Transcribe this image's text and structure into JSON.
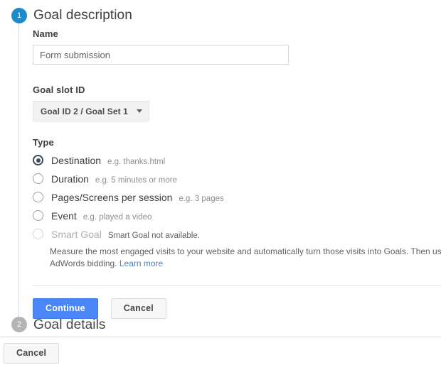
{
  "steps": [
    {
      "number": "1",
      "title": "Goal description",
      "color": "#1f8ac9"
    },
    {
      "number": "2",
      "title": "Goal details",
      "color": "#b4b4b4"
    }
  ],
  "form": {
    "name_label": "Name",
    "name_value": "Form submission",
    "name_placeholder": "",
    "slot_label": "Goal slot ID",
    "slot_value": "Goal ID 2 / Goal Set 1",
    "type_label": "Type"
  },
  "type_options": [
    {
      "label": "Destination",
      "hint": "e.g. thanks.html",
      "selected": true,
      "disabled": false
    },
    {
      "label": "Duration",
      "hint": "e.g. 5 minutes or more",
      "selected": false,
      "disabled": false
    },
    {
      "label": "Pages/Screens per session",
      "hint": "e.g. 3 pages",
      "selected": false,
      "disabled": false
    },
    {
      "label": "Event",
      "hint": "e.g. played a video",
      "selected": false,
      "disabled": false
    },
    {
      "label": "Smart Goal",
      "hint": "Smart Goal not available.",
      "selected": false,
      "disabled": true
    }
  ],
  "smart_goal": {
    "description": "Measure the most engaged visits to your website and automatically turn those visits into Goals. Then use those improve your AdWords bidding.",
    "link_label": "Learn more"
  },
  "buttons": {
    "continue_label": "Continue",
    "cancel_label": "Cancel",
    "bottom_cancel_label": "Cancel",
    "primary_color": "#4a86f7"
  }
}
